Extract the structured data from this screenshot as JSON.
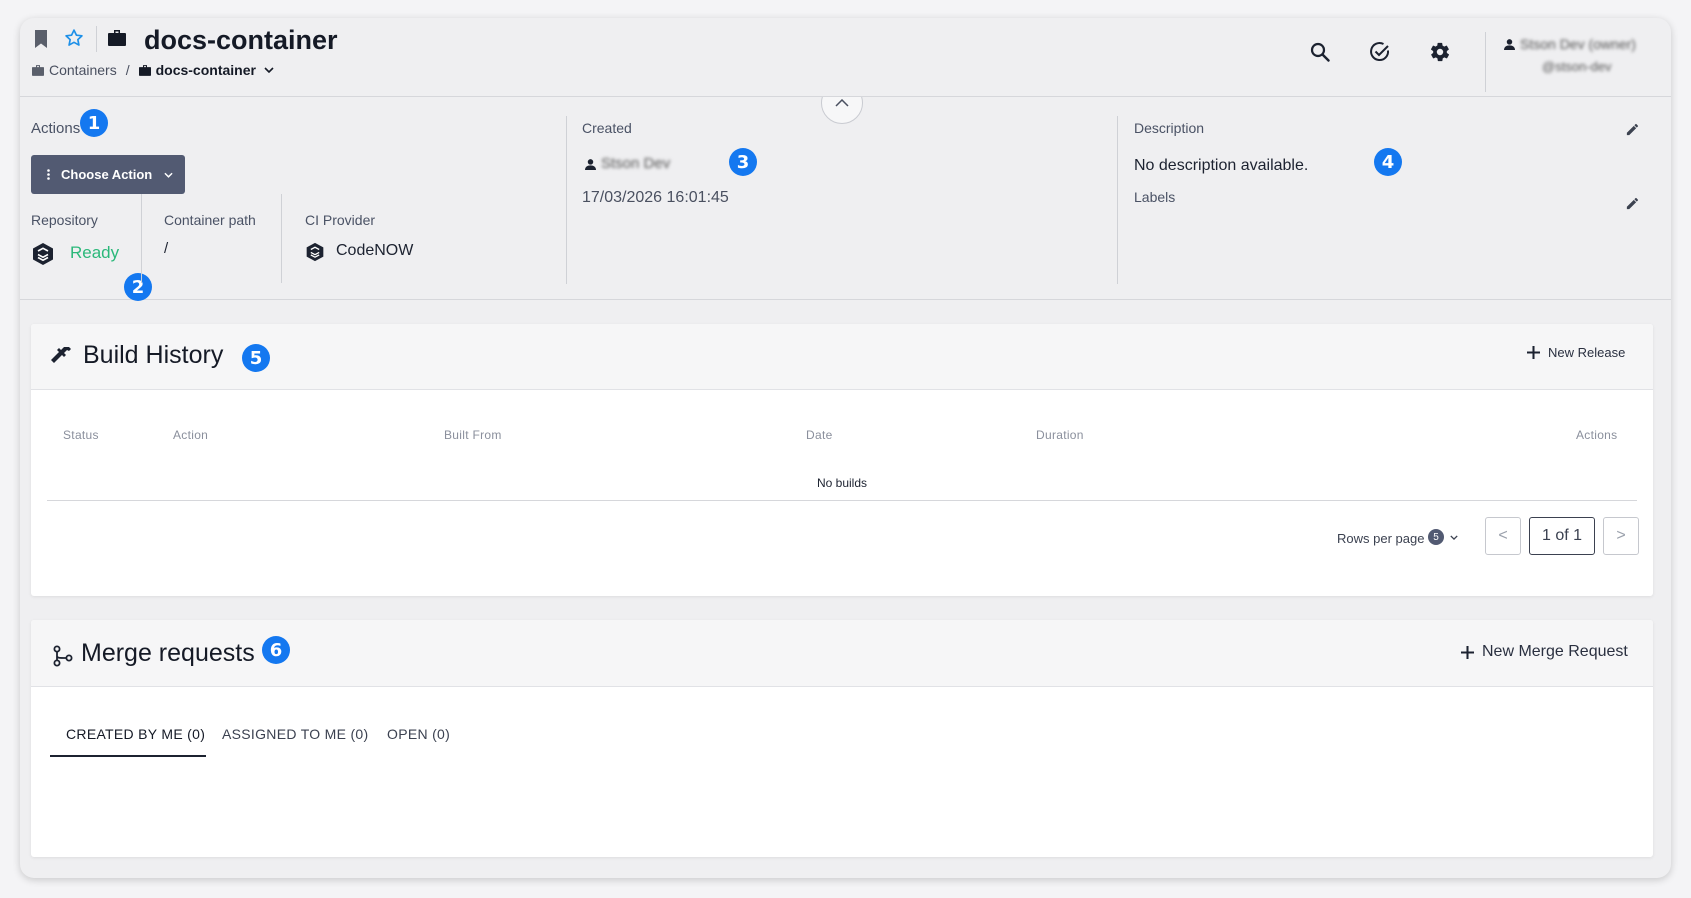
{
  "header": {
    "title": "docs-container",
    "breadcrumb": {
      "root": "Containers",
      "separator": "/",
      "current": "docs-container"
    },
    "user": {
      "name": "Stson Dev (owner)",
      "handle": "@stson-dev"
    }
  },
  "overview": {
    "actions_label": "Actions",
    "choose_action": "Choose Action",
    "repository": {
      "label": "Repository",
      "status": "Ready",
      "status_color": "#2bb87a"
    },
    "container_path": {
      "label": "Container path",
      "value": "/"
    },
    "ci_provider": {
      "label": "CI Provider",
      "value": "CodeNOW"
    },
    "created": {
      "label": "Created",
      "user": "Stson Dev",
      "date": "17/03/2026 16:01:45"
    },
    "description": {
      "label": "Description",
      "value": "No description available."
    },
    "labels": {
      "label": "Labels"
    }
  },
  "build_history": {
    "title": "Build History",
    "new_release": "New Release",
    "columns": [
      "Status",
      "Action",
      "Built From",
      "Date",
      "Duration",
      "Actions"
    ],
    "empty": "No builds",
    "rows_per_page_label": "Rows per page",
    "rows_per_page": "5",
    "prev": "<",
    "page": "1 of 1",
    "next": ">"
  },
  "merge_requests": {
    "title": "Merge requests",
    "new_merge_request": "New Merge Request",
    "tabs": [
      "CREATED BY ME (0)",
      "ASSIGNED TO ME (0)",
      "OPEN (0)"
    ]
  },
  "annotations": [
    "1",
    "2",
    "3",
    "4",
    "5",
    "6"
  ],
  "colors": {
    "accent": "#1478f0",
    "star": "#1e90e8",
    "button": "#525a72",
    "ready": "#2bb87a"
  },
  "icons": [
    "bookmark-icon",
    "star-icon",
    "briefcase-icon",
    "search-icon",
    "check-circle-icon",
    "gear-icon",
    "user-icon",
    "chevron-up-icon",
    "chevron-down-icon",
    "kebab-icon",
    "repository-icon",
    "codenow-icon",
    "pencil-icon",
    "hammer-icon",
    "plus-icon",
    "merge-icon"
  ]
}
